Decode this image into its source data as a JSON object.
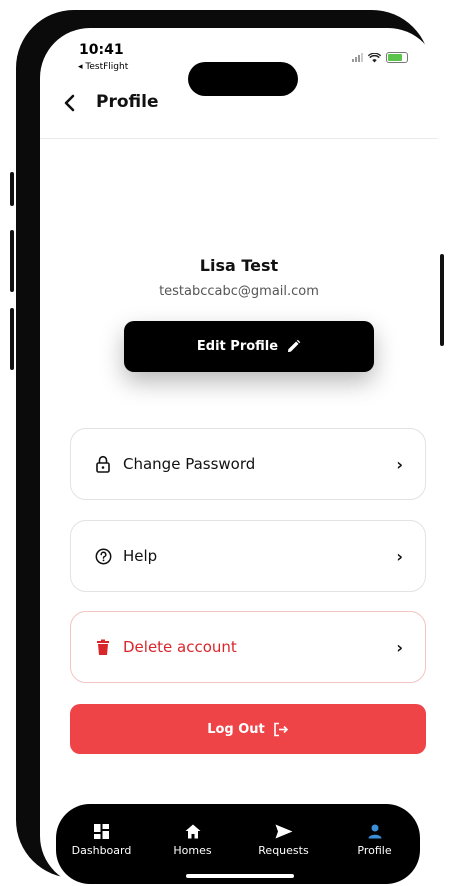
{
  "status_bar": {
    "time": "10:41",
    "back_app": "◂ TestFlight"
  },
  "header": {
    "title": "Profile"
  },
  "profile": {
    "name": "Lisa Test",
    "email": "testabccabc@gmail.com",
    "edit_label": "Edit Profile"
  },
  "menu": {
    "items": [
      {
        "label": "Change Password",
        "icon": "lock-icon"
      },
      {
        "label": "Help",
        "icon": "help-circle-icon"
      },
      {
        "label": "Delete account",
        "icon": "trash-icon"
      }
    ]
  },
  "logout": {
    "label": "Log Out"
  },
  "tabs": [
    {
      "label": "Dashboard",
      "icon": "dashboard-icon"
    },
    {
      "label": "Homes",
      "icon": "home-icon"
    },
    {
      "label": "Requests",
      "icon": "send-icon"
    },
    {
      "label": "Profile",
      "icon": "person-icon"
    }
  ],
  "colors": {
    "danger": "#d9262b",
    "logout_bg": "#ee4448",
    "active_tab": "#3b8fd6",
    "primary": "#000000"
  }
}
